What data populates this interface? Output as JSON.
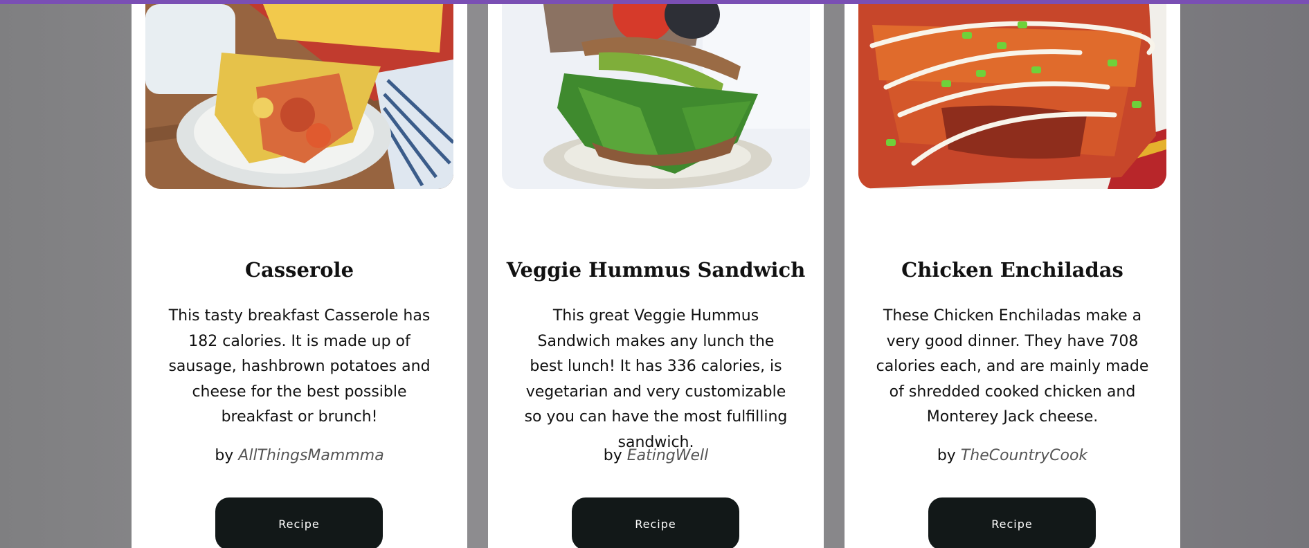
{
  "recipes": [
    {
      "title": "Casserole",
      "description": "This tasty breakfast Casserole has 182 calories. It is made up of sausage, hashbrown potatoes and cheese for the best possible breakfast or brunch!",
      "by": "by",
      "author": "AllThingsMammma",
      "button": "Recipe"
    },
    {
      "title": "Veggie Hummus Sandwich",
      "description": "This great Veggie Hummus Sandwich makes any lunch the best lunch! It has 336 calories, is vegetarian and very customizable so you can have the most fulfilling sandwich.",
      "by": "by",
      "author": "EatingWell",
      "button": "Recipe"
    },
    {
      "title": "Chicken Enchiladas",
      "description": "These Chicken Enchiladas make a very good dinner. They have 708 calories each, and are mainly made of shredded cooked chicken and Monterey Jack cheese.",
      "by": "by",
      "author": "TheCountryCook",
      "button": "Recipe"
    }
  ],
  "colors": {
    "accent_bar": "#7a4fb4",
    "button_bg": "#121818",
    "card_bg": "#ffffff"
  }
}
